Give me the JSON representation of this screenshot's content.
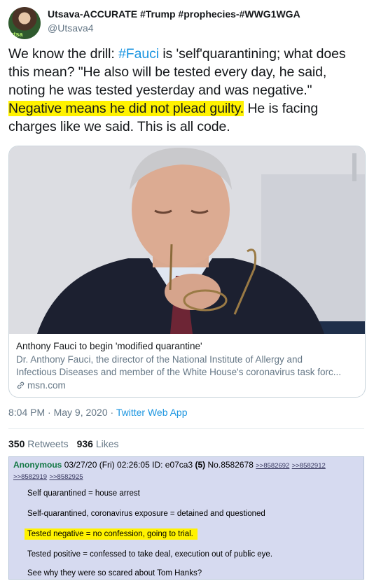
{
  "user": {
    "display_name": "Utsava-ACCURATE #Trump #prophecies-#WWG1WGA",
    "handle": "@Utsava4",
    "avatar_label": "utsa"
  },
  "tweet": {
    "t1": "We know the drill: ",
    "hashtag": "#Fauci",
    "t2": " is 'self'quarantining; what does this mean? \"He also will be tested every day, he said, noting he was tested yesterday and was negative.\" ",
    "highlight": "Negative means he did not plead guilty.",
    "t3": " He is facing charges like we said. This is all code."
  },
  "card": {
    "title": "Anthony Fauci to begin 'modified quarantine'",
    "description_line1": "Dr. Anthony Fauci, the director of the National Institute of Allergy and",
    "description_line2": "Infectious Diseases and member of the White House's coronavirus task forc...",
    "domain": "msn.com"
  },
  "meta": {
    "timestamp": "8:04 PM · May 9, 2020 · ",
    "source": "Twitter Web App"
  },
  "stats": {
    "retweets_count": "350",
    "retweets_label": "Retweets",
    "likes_count": "936",
    "likes_label": "Likes"
  },
  "chan_post": {
    "name": "Anonymous",
    "date": "03/27/20 (Fri) 02:26:05",
    "id": "ID: e07ca3",
    "replies": "(5)",
    "post_no": "No.8582678",
    "links": [
      ">>8582692",
      ">>8582912",
      ">>8582919",
      ">>8582925"
    ],
    "lines": [
      "Self quarantined = house arrest",
      "Self-quarantined, coronavirus exposure = detained and questioned",
      "Tested negative = no confession, going to trial.",
      "Tested positive = confessed to take deal, execution out of public eye.",
      "See why they were so scared about Tom Hanks?"
    ]
  },
  "colors": {
    "link_blue": "#1b95e0",
    "highlight_yellow": "#fff200",
    "chan_background": "#d6daf0",
    "chan_name_green": "#117743"
  }
}
